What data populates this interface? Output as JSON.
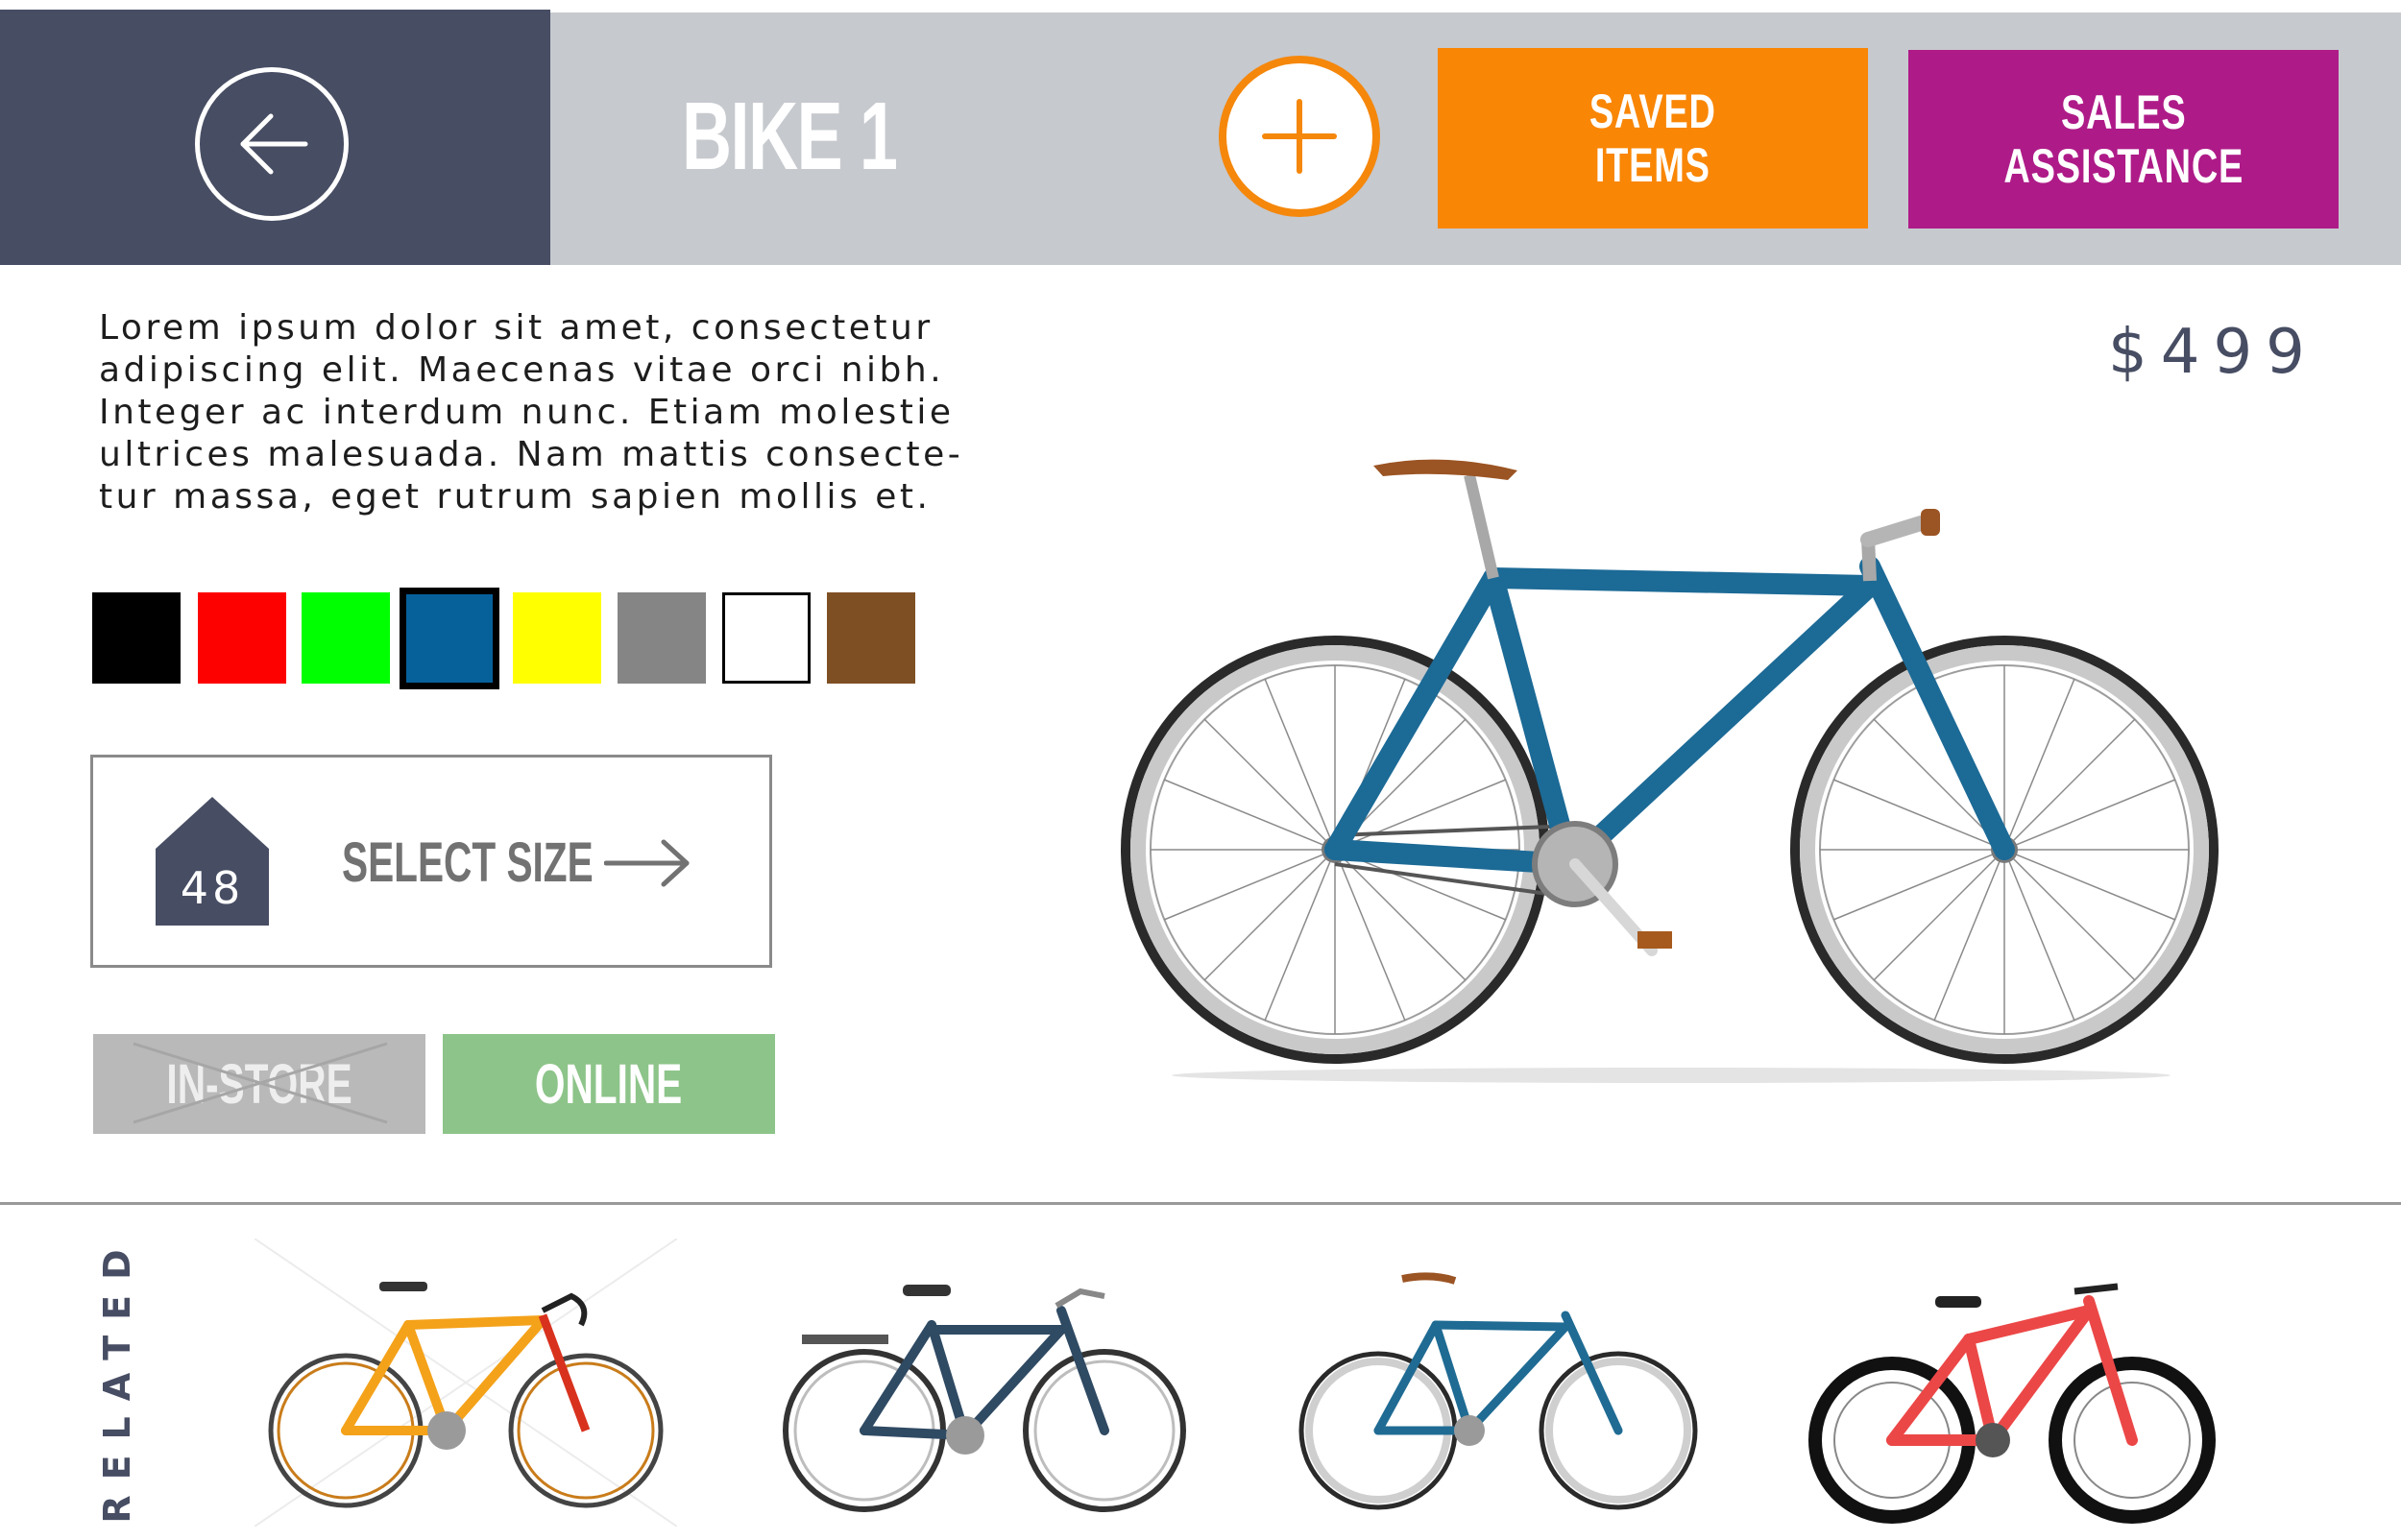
{
  "header": {
    "back_icon": "arrow-left-icon",
    "title": "BIKE 1",
    "add_icon": "plus-icon",
    "saved_items_label": "SAVED\nITEMS",
    "sales_assistance_label": "SALES\nASSISTANCE",
    "colors": {
      "header_dark": "#474d63",
      "header_light": "#c6c9ce",
      "accent_orange": "#f98605",
      "accent_purple": "#ae1b88"
    }
  },
  "product": {
    "description_lines": [
      "Lorem ipsum dolor sit amet, consectetur",
      "adipiscing elit. Maecenas vitae orci nibh.",
      "Integer ac interdum nunc. Etiam molestie",
      "ultrices malesuada. Nam mattis consecte-",
      "tur massa, eget rutrum sapien mollis et."
    ],
    "price": "$499",
    "colors": [
      {
        "name": "black",
        "hex": "#000000"
      },
      {
        "name": "red",
        "hex": "#fd0000"
      },
      {
        "name": "green",
        "hex": "#00ff00"
      },
      {
        "name": "blue",
        "hex": "#06619b",
        "selected": true
      },
      {
        "name": "yellow",
        "hex": "#ffff00"
      },
      {
        "name": "gray",
        "hex": "#858585"
      },
      {
        "name": "white",
        "hex": "#ffffff"
      },
      {
        "name": "brown",
        "hex": "#7f4f24"
      }
    ],
    "size": {
      "value": "48",
      "label": "SELECT SIZE",
      "arrow_icon": "arrow-right-icon"
    },
    "availability": {
      "in_store_label": "IN-STORE",
      "in_store_available": false,
      "online_label": "ONLINE",
      "online_available": true
    }
  },
  "related": {
    "label": "RELATED",
    "items": [
      {
        "name": "orange-road-bike",
        "frame_color": "#f4a21a"
      },
      {
        "name": "navy-touring-bike",
        "frame_color": "#2f4a63"
      },
      {
        "name": "blue-fixie-bike",
        "frame_color": "#1f6b93"
      },
      {
        "name": "red-mountain-bike",
        "frame_color": "#ec4747"
      }
    ]
  }
}
